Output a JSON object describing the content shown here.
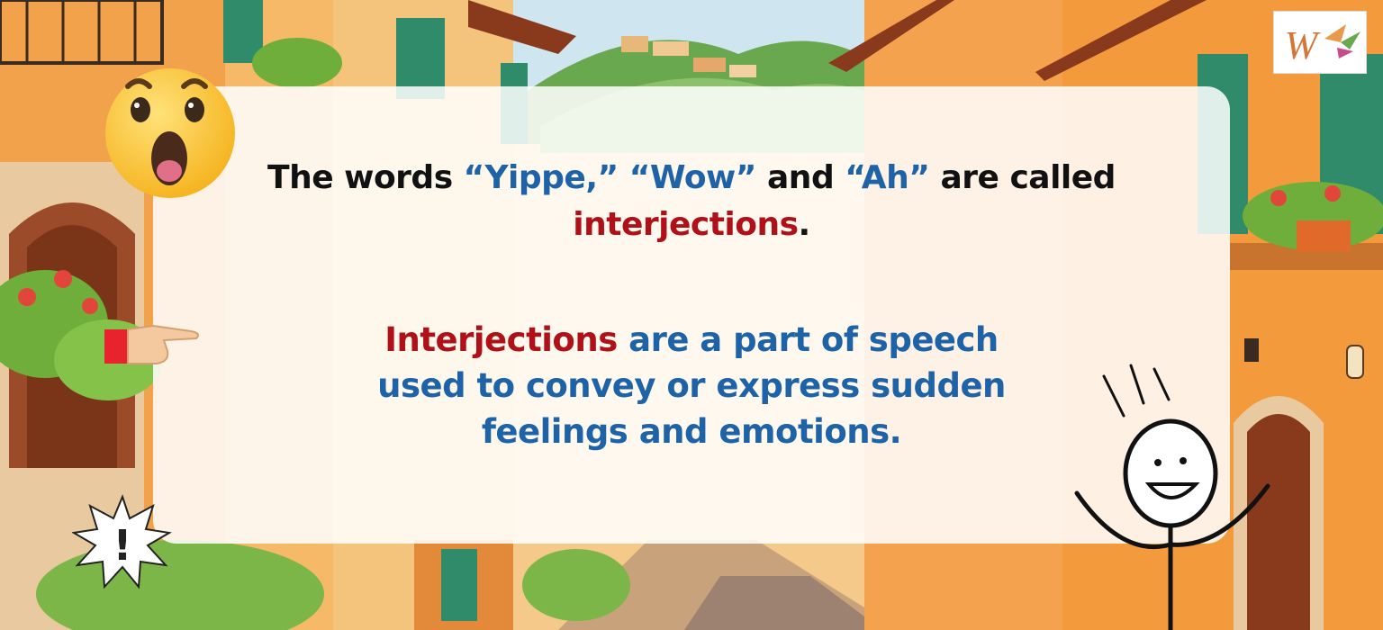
{
  "slide": {
    "line1_prefix": "The words ",
    "word1": "“Yippe,”",
    "word2": "“Wow”",
    "line1_and": " and ",
    "word3": "“Ah”",
    "line1_suffix": " are called",
    "term": "interjections",
    "period": ".",
    "def_term": "Interjections",
    "def_rest_1": " are a part of speech",
    "def_line2": "used to convey or express sudden",
    "def_line3": "feelings and emotions."
  },
  "logo": {
    "letter": "W"
  },
  "exclaim": {
    "glyph": "!"
  },
  "colors": {
    "blue": "#1e63a8",
    "red": "#b01018",
    "text": "#111111"
  }
}
